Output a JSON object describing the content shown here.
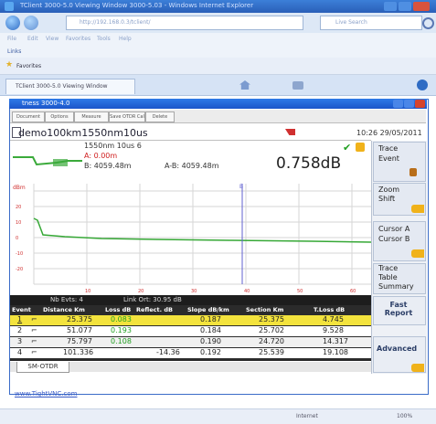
{
  "ie": {
    "title": "TClient 3000-5.0 Viewing Window 3000-5.03 - Windows Internet Explorer",
    "address": "http://192.168.0.3/tclient/",
    "search_placeholder": "Live Search",
    "menu": [
      "File",
      "Edit",
      "View",
      "Favorites",
      "Tools",
      "Help"
    ],
    "links_label": "Links",
    "fav_label": "Favorites",
    "tab_label": "TClient 3000-5.0 Viewing Window",
    "status_zone": "Internet",
    "zoom": "100%",
    "footer_link": "www.TightVNC.com"
  },
  "app": {
    "title": "tness 3000-4.0",
    "menu": [
      "Document",
      "Options",
      "Measure",
      "Save OTDR Cal",
      "Delete"
    ],
    "trace_name": "demo100km1550nm10us",
    "time": "10:26 29/05/2011",
    "info": {
      "line1": "1550nm  10us  6",
      "cursor_a": "A: 0.00m",
      "cursor_b": "B: 4059.48m",
      "ab": "A-B: 4059.48m",
      "loss": "0.758dB"
    },
    "chart_ylabel": "dBm",
    "table": {
      "status_events": "Nb Evts: 4",
      "status_link": "Link Ort: 30.95 dB",
      "headers": [
        "Event",
        "Distance Km",
        "Loss dB",
        "Reflect. dB",
        "Slope dB/km",
        "Section Km",
        "T.Loss dB"
      ],
      "rows": [
        {
          "event": "1",
          "distance": "25.375",
          "loss": "0.083",
          "reflect": "",
          "slope": "0.187",
          "section": "25.375",
          "tloss": "4.745"
        },
        {
          "event": "2",
          "distance": "51.077",
          "loss": "0.193",
          "reflect": "",
          "slope": "0.184",
          "section": "25.702",
          "tloss": "9.528"
        },
        {
          "event": "3",
          "distance": "75.797",
          "loss": "0.108",
          "reflect": "",
          "slope": "0.190",
          "section": "24.720",
          "tloss": "14.317"
        },
        {
          "event": "4",
          "distance": "101.336",
          "loss": "",
          "reflect": "-14.36",
          "slope": "0.192",
          "section": "25.539",
          "tloss": "19.108"
        }
      ]
    },
    "bottom_tab": "SM-OTDR",
    "side": {
      "group1": [
        "Trace",
        "Event"
      ],
      "group2": [
        "Zoom",
        "Shift"
      ],
      "group3": [
        "Cursor A",
        "Cursor B"
      ],
      "group4": [
        "Trace",
        "Table",
        "Summary"
      ],
      "fast_report": "Fast Report",
      "advanced": "Advanced"
    }
  }
}
